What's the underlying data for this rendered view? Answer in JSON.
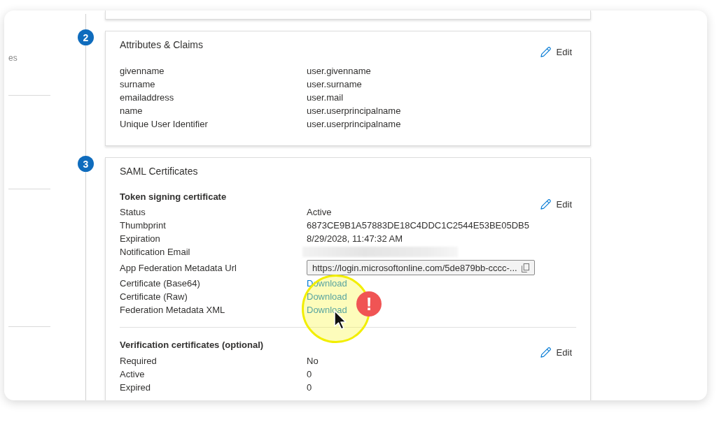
{
  "sidebar": {
    "fragment": "es"
  },
  "sections": [
    {
      "step": "2",
      "title": "Attributes & Claims",
      "edit": "Edit",
      "groups": [
        {
          "rows": [
            {
              "kind": "text",
              "label": "givenname",
              "value": "user.givenname"
            },
            {
              "kind": "text",
              "label": "surname",
              "value": "user.surname"
            },
            {
              "kind": "text",
              "label": "emailaddress",
              "value": "user.mail"
            },
            {
              "kind": "text",
              "label": "name",
              "value": "user.userprincipalname"
            },
            {
              "kind": "text",
              "label": "Unique User Identifier",
              "value": "user.userprincipalname"
            }
          ]
        }
      ]
    },
    {
      "step": "3",
      "title": "SAML Certificates",
      "groups": [
        {
          "heading": "Token signing certificate",
          "edit": "Edit",
          "rows": [
            {
              "kind": "text",
              "label": "Status",
              "value": "Active"
            },
            {
              "kind": "text",
              "label": "Thumbprint",
              "value": "6873CE9B1A57883DE18C4DDC1C2544E53BE05DB5"
            },
            {
              "kind": "text",
              "label": "Expiration",
              "value": "8/29/2028, 11:47:32 AM"
            },
            {
              "kind": "redacted",
              "label": "Notification Email"
            },
            {
              "kind": "url",
              "label": "App Federation Metadata Url",
              "value": "https://login.microsoftonline.com/5de879bb-cccc-..."
            },
            {
              "kind": "link",
              "label": "Certificate (Base64)",
              "value": "Download"
            },
            {
              "kind": "link",
              "label": "Certificate (Raw)",
              "value": "Download"
            },
            {
              "kind": "link",
              "label": "Federation Metadata XML",
              "value": "Download"
            }
          ]
        },
        {
          "heading": "Verification certificates (optional)",
          "edit": "Edit",
          "rows": [
            {
              "kind": "text",
              "label": "Required",
              "value": "No"
            },
            {
              "kind": "text",
              "label": "Active",
              "value": "0"
            },
            {
              "kind": "text",
              "label": "Expired",
              "value": "0"
            }
          ]
        }
      ]
    }
  ],
  "annotation": {
    "mark": "!"
  }
}
